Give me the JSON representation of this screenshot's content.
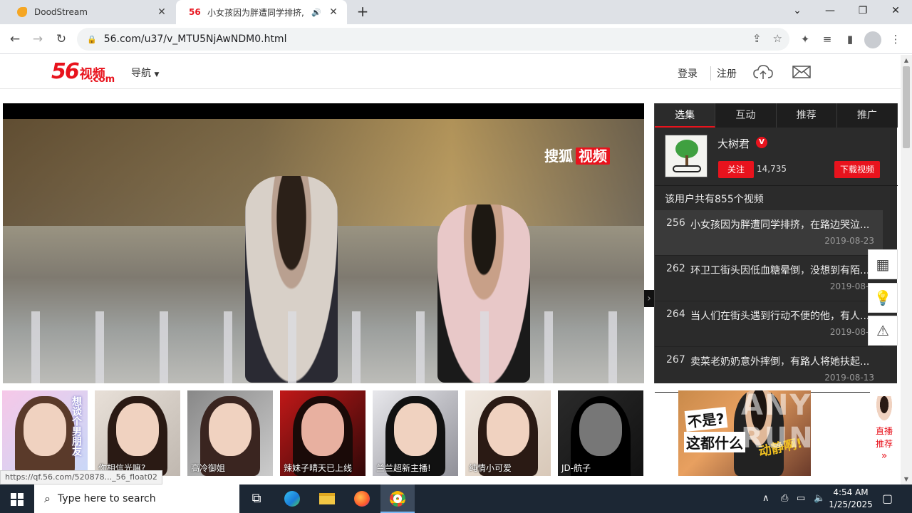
{
  "browser": {
    "tabs": [
      {
        "title": "DoodStream"
      },
      {
        "title": "小女孩因为胖遭同学排挤,"
      }
    ],
    "new_tab": "+",
    "window_controls": {
      "minimize": "—",
      "restore": "❐",
      "close": "✕",
      "dropdown": "⌄"
    },
    "url": "56.com/u37/v_MTU5NjAwNDM0.html"
  },
  "site": {
    "logo_num": "56",
    "logo_cn": "视频",
    "logo_com": ".com",
    "nav_label": "导航",
    "login": "登录",
    "register": "注册"
  },
  "player": {
    "watermark_text": "搜狐",
    "watermark_red": "视频"
  },
  "sidebar": {
    "tabs": [
      "选集",
      "互动",
      "推荐",
      "推广"
    ],
    "uploader_name": "大树君",
    "verified": "V",
    "follow_label": "关注",
    "fans_count": "14,735",
    "download_label": "下载视频",
    "video_count_text": "该用户共有855个视频",
    "videos": [
      {
        "num": "256",
        "title": "小女孩因为胖遭同学排挤，在路边哭泣...",
        "date": "2019-08-23"
      },
      {
        "num": "262",
        "title": "环卫工街头因低血糖晕倒，没想到有陌...",
        "date": "2019-08-2"
      },
      {
        "num": "264",
        "title": "当人们在街头遇到行动不便的他，有人...",
        "date": "2019-08-1"
      },
      {
        "num": "267",
        "title": "卖菜老奶奶意外摔倒，有路人将她扶起...",
        "date": "2019-08-13"
      }
    ]
  },
  "ads": [
    {
      "caption": ""
    },
    {
      "caption": "你相信光嘛?"
    },
    {
      "caption": "高冷御姐"
    },
    {
      "caption": "辣妹子晴天已上线"
    },
    {
      "caption": "兰兰超新主播!"
    },
    {
      "caption": "纯情小可爱"
    },
    {
      "caption": "JD-航子"
    }
  ],
  "first_ad_text": "想谈个男朋友",
  "big_ad": {
    "line1": "不是?",
    "line2": "这都什么",
    "line3": "动静啊!"
  },
  "live": {
    "line1": "直播",
    "line2": "推荐",
    "arrow": "»"
  },
  "status_url": "https://qf.56.com/520878..._56_float02",
  "taskbar": {
    "search_placeholder": "Type here to search",
    "time": "4:54 AM",
    "date": "1/25/2025"
  },
  "colors": {
    "brand_red": "#e8131d",
    "taskbar": "#1c2734",
    "sidebar_bg": "#2b2b2b"
  }
}
